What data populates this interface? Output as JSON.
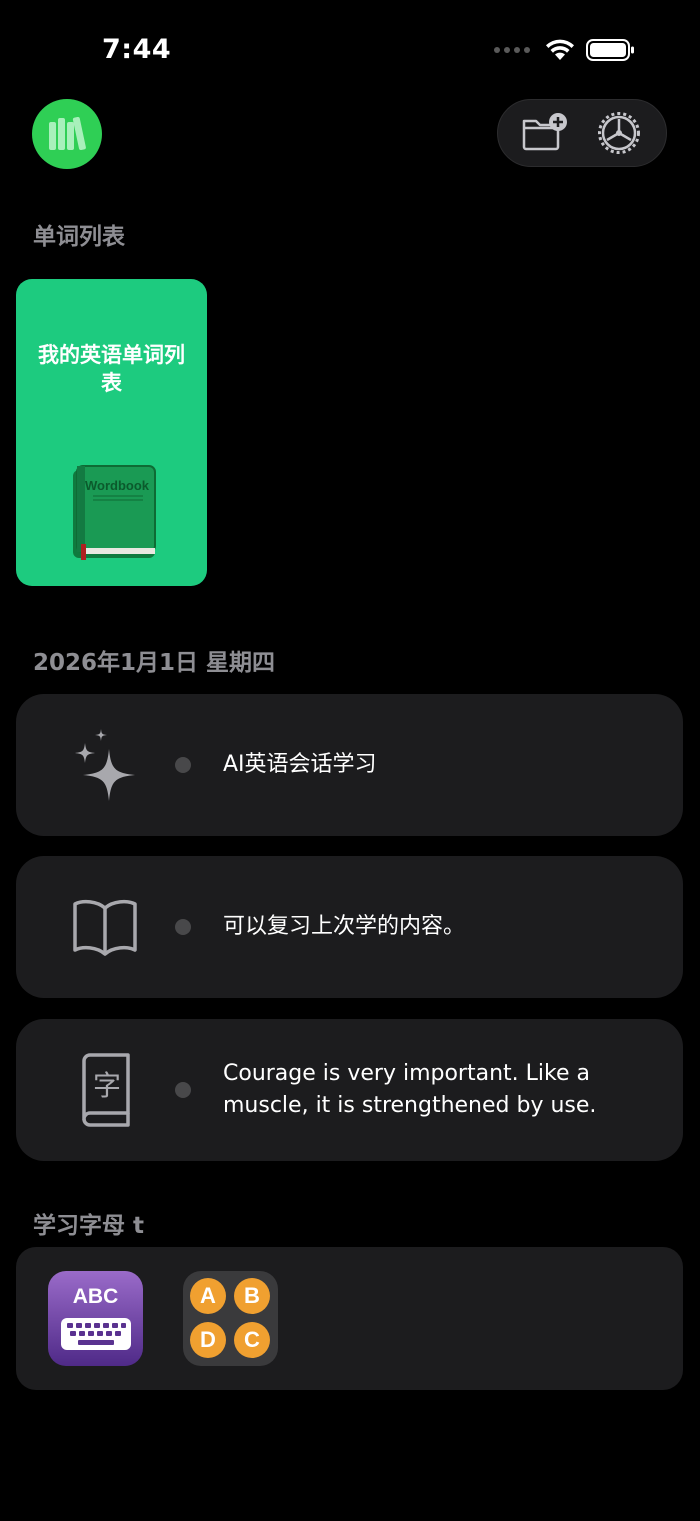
{
  "status_bar": {
    "time": "7:44"
  },
  "sections": {
    "wordlists_title": "单词列表",
    "date_title": "2026年1月1日 星期四",
    "alphabet_title": "学习字母 t"
  },
  "wordbook": {
    "title": "我的英语单词列表",
    "cover_text": "Wordbook"
  },
  "rows": [
    {
      "icon": "sparkles-icon",
      "text": "AI英语会话学习"
    },
    {
      "icon": "book-icon",
      "text": "可以复习上次学的内容。"
    },
    {
      "icon": "character-book-icon",
      "text": "Courage is very important. Like a muscle, it is strengthened by use."
    }
  ],
  "alphabet_apps": [
    {
      "icon": "abc-keyboard-icon",
      "label": "ABC"
    },
    {
      "icon": "abcd-circles-icon",
      "letters": [
        "A",
        "B",
        "D",
        "C"
      ]
    }
  ],
  "colors": {
    "background": "#000000",
    "card": "#1c1c1e",
    "accent_green": "#2fcf55",
    "wordbook_green": "#1dcb7f",
    "secondary_text": "#8e8e93",
    "orange": "#f0a030"
  }
}
